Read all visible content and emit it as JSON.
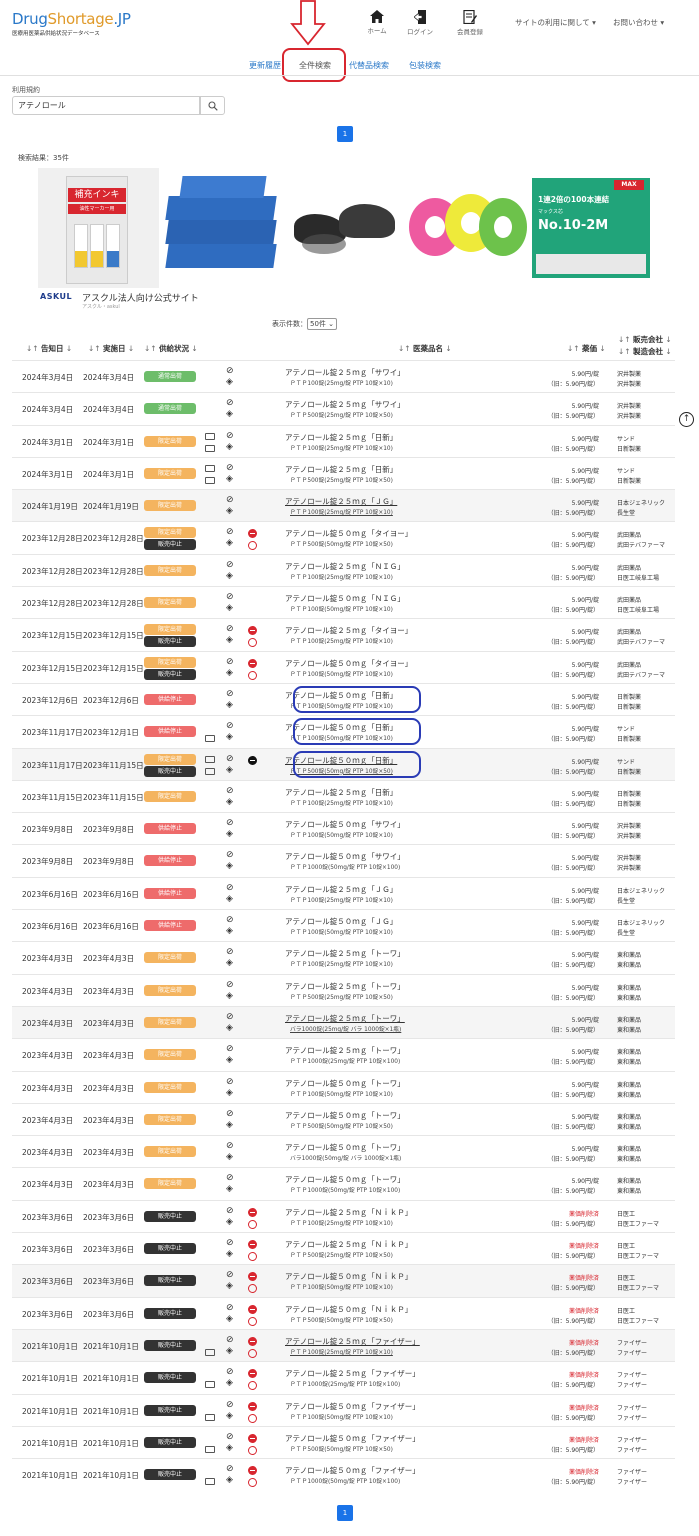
{
  "header": {
    "logo_main_a": "Drug",
    "logo_main_b": "Shortage",
    "logo_main_c": ".JP",
    "logo_sub": "医療用医薬品供給状況データベース",
    "nav": [
      {
        "icon": "home-icon",
        "label": "ホーム"
      },
      {
        "icon": "login-icon",
        "label": "ログイン"
      },
      {
        "icon": "register-icon",
        "label": "会員登録"
      }
    ],
    "about_menu": "サイトの利用に関して",
    "contact_menu": "お問い合わせ"
  },
  "tabs": [
    {
      "label": "更新履歴"
    },
    {
      "label": "全件検索"
    },
    {
      "label": "代替品検索"
    },
    {
      "label": "包装検索"
    }
  ],
  "search": {
    "label": "利用規約",
    "value": "アテノロール"
  },
  "pagination": {
    "current": "1"
  },
  "result_count": "検索結果：35件",
  "ad": {
    "brand": "ASKUL",
    "title": "アスクル法人向け公式サイト",
    "sub": "アスクル・askul",
    "tile_texts": {
      "ink_title": "補充インキ",
      "ink_sub": "油性マーカー用",
      "staple_top": "1連2倍の100本連結",
      "staple_brand": "マックス芯",
      "staple_model": "No.10-2M",
      "staple_brand2": "MAX"
    }
  },
  "per_page": {
    "label": "表示件数：",
    "value": "50件"
  },
  "columns": {
    "announce": "告知日",
    "effective": "実施日",
    "status": "供給状況",
    "name": "医薬品名",
    "price": "薬価",
    "seller": "販売会社",
    "maker": "製造会社"
  },
  "rows": [
    {
      "d1": "2024年3月4日",
      "d2": "2024年3月4日",
      "b1": "通常出荷",
      "c1": "green",
      "chat": 0,
      "stop": 0,
      "name": "アテノロール錠２５ｍｇ「サワイ」",
      "pkg": "ＰＴＰ100錠(25mg/錠 PTP 10錠×10)",
      "p1": "5.90円/錠",
      "p2": "（旧：5.90円/錠）",
      "co1": "沢井製薬",
      "co2": "沢井製薬"
    },
    {
      "d1": "2024年3月4日",
      "d2": "2024年3月4日",
      "b1": "通常出荷",
      "c1": "green",
      "chat": 0,
      "stop": 0,
      "name": "アテノロール錠２５ｍｇ「サワイ」",
      "pkg": "ＰＴＰ500錠(25mg/錠 PTP 10錠×50)",
      "p1": "5.90円/錠",
      "p2": "（旧：5.90円/錠）",
      "co1": "沢井製薬",
      "co2": "沢井製薬"
    },
    {
      "d1": "2024年3月1日",
      "d2": "2024年3月1日",
      "b1": "限定出荷",
      "c1": "orange",
      "chat": 2,
      "stop": 0,
      "name": "アテノロール錠２５ｍｇ「日新」",
      "pkg": "ＰＴＰ100錠(25mg/錠 PTP 10錠×10)",
      "p1": "5.90円/錠",
      "p2": "（旧：5.90円/錠）",
      "co1": "サンド",
      "co2": "日新製薬"
    },
    {
      "d1": "2024年3月1日",
      "d2": "2024年3月1日",
      "b1": "限定出荷",
      "c1": "orange",
      "chat": 2,
      "stop": 0,
      "name": "アテノロール錠２５ｍｇ「日新」",
      "pkg": "ＰＴＰ500錠(25mg/錠 PTP 10錠×50)",
      "p1": "5.90円/錠",
      "p2": "（旧：5.90円/錠）",
      "co1": "サンド",
      "co2": "日新製薬"
    },
    {
      "d1": "2024年1月19日",
      "d2": "2024年1月19日",
      "b1": "限定出荷",
      "c1": "orange",
      "chat": 0,
      "stop": 0,
      "alt": 1,
      "ul": 1,
      "name": "アテノロール錠２５ｍｇ「ＪＧ」",
      "pkg": "ＰＴＰ100錠(25mg/錠 PTP 10錠×10)",
      "p1": "5.90円/錠",
      "p2": "（旧：5.90円/錠）",
      "co1": "日本ジェネリック",
      "co2": "長生堂"
    },
    {
      "d1": "2023年12月28日",
      "d2": "2023年12月28日",
      "b1": "限定出荷",
      "c1": "orange",
      "b2": "販売中止",
      "chat": 0,
      "stop": 1,
      "name": "アテノロール錠５０ｍｇ「タイヨー」",
      "pkg": "ＰＴＰ500錠(50mg/錠 PTP 10錠×50)",
      "p1": "5.90円/錠",
      "p2": "（旧：5.90円/錠）",
      "co1": "武田薬品",
      "co2": "武田テバファーマ"
    },
    {
      "d1": "2023年12月28日",
      "d2": "2023年12月28日",
      "b1": "限定出荷",
      "c1": "orange",
      "chat": 0,
      "stop": 0,
      "name": "アテノロール錠２５ｍｇ「ＮＩＧ」",
      "pkg": "ＰＴＰ100錠(25mg/錠 PTP 10錠×10)",
      "p1": "5.90円/錠",
      "p2": "（旧：5.90円/錠）",
      "co1": "武田薬品",
      "co2": "日医工岐阜工場"
    },
    {
      "d1": "2023年12月28日",
      "d2": "2023年12月28日",
      "b1": "限定出荷",
      "c1": "orange",
      "chat": 0,
      "stop": 0,
      "name": "アテノロール錠５０ｍｇ「ＮＩＧ」",
      "pkg": "ＰＴＰ100錠(50mg/錠 PTP 10錠×10)",
      "p1": "5.90円/錠",
      "p2": "（旧：5.90円/錠）",
      "co1": "武田薬品",
      "co2": "日医工岐阜工場"
    },
    {
      "d1": "2023年12月15日",
      "d2": "2023年12月15日",
      "b1": "限定出荷",
      "c1": "orange",
      "b2": "販売中止",
      "chat": 0,
      "stop": 1,
      "name": "アテノロール錠２５ｍｇ「タイヨー」",
      "pkg": "ＰＴＰ100錠(25mg/錠 PTP 10錠×10)",
      "p1": "5.90円/錠",
      "p2": "（旧：5.90円/錠）",
      "co1": "武田薬品",
      "co2": "武田テバファーマ"
    },
    {
      "d1": "2023年12月15日",
      "d2": "2023年12月15日",
      "b1": "限定出荷",
      "c1": "orange",
      "b2": "販売中止",
      "chat": 0,
      "stop": 1,
      "name": "アテノロール錠５０ｍｇ「タイヨー」",
      "pkg": "ＰＴＰ100錠(50mg/錠 PTP 10錠×10)",
      "p1": "5.90円/錠",
      "p2": "（旧：5.90円/錠）",
      "co1": "武田薬品",
      "co2": "武田テバファーマ"
    },
    {
      "d1": "2023年12月6日",
      "d2": "2023年12月6日",
      "b1": "供給停止",
      "c1": "red",
      "chat": 0,
      "stop": 0,
      "hl": 1,
      "name": "アテノロール錠５０ｍｇ「日新」",
      "pkg": "ＰＴＰ100錠(50mg/錠 PTP 10錠×10)",
      "p1": "5.90円/錠",
      "p2": "（旧：5.90円/錠）",
      "co1": "日新製薬",
      "co2": "日新製薬"
    },
    {
      "d1": "2023年11月17日",
      "d2": "2023年12月1日",
      "b1": "供給停止",
      "c1": "red",
      "chat": 1,
      "stop": 0,
      "hl": 1,
      "name": "アテノロール錠５０ｍｇ「日新」",
      "pkg": "ＰＴＰ100錠(50mg/錠 PTP 10錠×10)",
      "p1": "5.90円/錠",
      "p2": "（旧：5.90円/錠）",
      "co1": "サンド",
      "co2": "日新製薬"
    },
    {
      "d1": "2023年11月17日",
      "d2": "2023年11月15日",
      "b1": "限定出荷",
      "c1": "orange",
      "b2": "販売中止",
      "chat": 2,
      "stop": 2,
      "hl": 1,
      "alt": 1,
      "ul": 1,
      "name": "アテノロール錠５０ｍｇ「日新」",
      "pkg": "ＰＴＰ500錠(50mg/錠 PTP 10錠×50)",
      "p1": "5.90円/錠",
      "p2": "（旧：5.90円/錠）",
      "co1": "サンド",
      "co2": "日新製薬"
    },
    {
      "d1": "2023年11月15日",
      "d2": "2023年11月15日",
      "b1": "限定出荷",
      "c1": "orange",
      "chat": 0,
      "stop": 0,
      "name": "アテノロール錠２５ｍｇ「日新」",
      "pkg": "ＰＴＰ100錠(25mg/錠 PTP 10錠×10)",
      "p1": "5.90円/錠",
      "p2": "（旧：5.90円/錠）",
      "co1": "日新製薬",
      "co2": "日新製薬"
    },
    {
      "d1": "2023年9月8日",
      "d2": "2023年9月8日",
      "b1": "供給停止",
      "c1": "red",
      "chat": 0,
      "stop": 0,
      "name": "アテノロール錠５０ｍｇ「サワイ」",
      "pkg": "ＰＴＰ100錠(50mg/錠 PTP 10錠×10)",
      "p1": "5.90円/錠",
      "p2": "（旧：5.90円/錠）",
      "co1": "沢井製薬",
      "co2": "沢井製薬"
    },
    {
      "d1": "2023年9月8日",
      "d2": "2023年9月8日",
      "b1": "供給停止",
      "c1": "red",
      "chat": 0,
      "stop": 0,
      "name": "アテノロール錠５０ｍｇ「サワイ」",
      "pkg": "ＰＴＰ1000錠(50mg/錠 PTP 10錠×100)",
      "p1": "5.90円/錠",
      "p2": "（旧：5.90円/錠）",
      "co1": "沢井製薬",
      "co2": "沢井製薬"
    },
    {
      "d1": "2023年6月16日",
      "d2": "2023年6月16日",
      "b1": "供給停止",
      "c1": "red",
      "chat": 0,
      "stop": 0,
      "name": "アテノロール錠２５ｍｇ「ＪＧ」",
      "pkg": "ＰＴＰ100錠(25mg/錠 PTP 10錠×10)",
      "p1": "5.90円/錠",
      "p2": "（旧：5.90円/錠）",
      "co1": "日本ジェネリック",
      "co2": "長生堂"
    },
    {
      "d1": "2023年6月16日",
      "d2": "2023年6月16日",
      "b1": "供給停止",
      "c1": "red",
      "chat": 0,
      "stop": 0,
      "name": "アテノロール錠５０ｍｇ「ＪＧ」",
      "pkg": "ＰＴＰ100錠(50mg/錠 PTP 10錠×10)",
      "p1": "5.90円/錠",
      "p2": "（旧：5.90円/錠）",
      "co1": "日本ジェネリック",
      "co2": "長生堂"
    },
    {
      "d1": "2023年4月3日",
      "d2": "2023年4月3日",
      "b1": "限定出荷",
      "c1": "orange",
      "chat": 0,
      "stop": 0,
      "name": "アテノロール錠２５ｍｇ「トーワ」",
      "pkg": "ＰＴＰ100錠(25mg/錠 PTP 10錠×10)",
      "p1": "5.90円/錠",
      "p2": "（旧：5.90円/錠）",
      "co1": "東和薬品",
      "co2": "東和薬品"
    },
    {
      "d1": "2023年4月3日",
      "d2": "2023年4月3日",
      "b1": "限定出荷",
      "c1": "orange",
      "chat": 0,
      "stop": 0,
      "name": "アテノロール錠２５ｍｇ「トーワ」",
      "pkg": "ＰＴＰ500錠(25mg/錠 PTP 10錠×50)",
      "p1": "5.90円/錠",
      "p2": "（旧：5.90円/錠）",
      "co1": "東和薬品",
      "co2": "東和薬品"
    },
    {
      "d1": "2023年4月3日",
      "d2": "2023年4月3日",
      "b1": "限定出荷",
      "c1": "orange",
      "chat": 0,
      "stop": 0,
      "alt": 1,
      "ul": 1,
      "name": "アテノロール錠２５ｍｇ「トーワ」",
      "pkg": "バラ1000錠(25mg/錠 バラ 1000錠×1瓶)",
      "p1": "5.90円/錠",
      "p2": "（旧：5.90円/錠）",
      "co1": "東和薬品",
      "co2": "東和薬品"
    },
    {
      "d1": "2023年4月3日",
      "d2": "2023年4月3日",
      "b1": "限定出荷",
      "c1": "orange",
      "chat": 0,
      "stop": 0,
      "name": "アテノロール錠２５ｍｇ「トーワ」",
      "pkg": "ＰＴＰ1000錠(25mg/錠 PTP 10錠×100)",
      "p1": "5.90円/錠",
      "p2": "（旧：5.90円/錠）",
      "co1": "東和薬品",
      "co2": "東和薬品"
    },
    {
      "d1": "2023年4月3日",
      "d2": "2023年4月3日",
      "b1": "限定出荷",
      "c1": "orange",
      "chat": 0,
      "stop": 0,
      "name": "アテノロール錠５０ｍｇ「トーワ」",
      "pkg": "ＰＴＰ100錠(50mg/錠 PTP 10錠×10)",
      "p1": "5.90円/錠",
      "p2": "（旧：5.90円/錠）",
      "co1": "東和薬品",
      "co2": "東和薬品"
    },
    {
      "d1": "2023年4月3日",
      "d2": "2023年4月3日",
      "b1": "限定出荷",
      "c1": "orange",
      "chat": 0,
      "stop": 0,
      "name": "アテノロール錠５０ｍｇ「トーワ」",
      "pkg": "ＰＴＰ500錠(50mg/錠 PTP 10錠×50)",
      "p1": "5.90円/錠",
      "p2": "（旧：5.90円/錠）",
      "co1": "東和薬品",
      "co2": "東和薬品"
    },
    {
      "d1": "2023年4月3日",
      "d2": "2023年4月3日",
      "b1": "限定出荷",
      "c1": "orange",
      "chat": 0,
      "stop": 0,
      "name": "アテノロール錠５０ｍｇ「トーワ」",
      "pkg": "バラ1000錠(50mg/錠 バラ 1000錠×1瓶)",
      "p1": "5.90円/錠",
      "p2": "（旧：5.90円/錠）",
      "co1": "東和薬品",
      "co2": "東和薬品"
    },
    {
      "d1": "2023年4月3日",
      "d2": "2023年4月3日",
      "b1": "限定出荷",
      "c1": "orange",
      "chat": 0,
      "stop": 0,
      "name": "アテノロール錠５０ｍｇ「トーワ」",
      "pkg": "ＰＴＰ1000錠(50mg/錠 PTP 10錠×100)",
      "p1": "5.90円/錠",
      "p2": "（旧：5.90円/錠）",
      "co1": "東和薬品",
      "co2": "東和薬品"
    },
    {
      "d1": "2023年3月6日",
      "d2": "2023年3月6日",
      "b1": "販売中止",
      "c1": "black",
      "chat": 0,
      "stop": 1,
      "name": "アテノロール錠２５ｍｇ「ＮｉｋＰ」",
      "pkg": "ＰＴＰ100錠(25mg/錠 PTP 10錠×10)",
      "p1": "薬価削除済",
      "p2": "（旧：5.90円/錠）",
      "pr": 1,
      "co1": "日医工",
      "co2": "日医工ファーマ"
    },
    {
      "d1": "2023年3月6日",
      "d2": "2023年3月6日",
      "b1": "販売中止",
      "c1": "black",
      "chat": 0,
      "stop": 1,
      "name": "アテノロール錠２５ｍｇ「ＮｉｋＰ」",
      "pkg": "ＰＴＰ500錠(25mg/錠 PTP 10錠×50)",
      "p1": "薬価削除済",
      "p2": "（旧：5.90円/錠）",
      "pr": 1,
      "co1": "日医工",
      "co2": "日医工ファーマ"
    },
    {
      "d1": "2023年3月6日",
      "d2": "2023年3月6日",
      "b1": "販売中止",
      "c1": "black",
      "chat": 0,
      "stop": 1,
      "alt": 1,
      "name": "アテノロール錠５０ｍｇ「ＮｉｋＰ」",
      "pkg": "ＰＴＰ100錠(50mg/錠 PTP 10錠×10)",
      "p1": "薬価削除済",
      "p2": "（旧：5.90円/錠）",
      "pr": 1,
      "co1": "日医工",
      "co2": "日医工ファーマ"
    },
    {
      "d1": "2023年3月6日",
      "d2": "2023年3月6日",
      "b1": "販売中止",
      "c1": "black",
      "chat": 0,
      "stop": 1,
      "name": "アテノロール錠５０ｍｇ「ＮｉｋＰ」",
      "pkg": "ＰＴＰ500錠(50mg/錠 PTP 10錠×50)",
      "p1": "薬価削除済",
      "p2": "（旧：5.90円/錠）",
      "pr": 1,
      "co1": "日医工",
      "co2": "日医工ファーマ"
    },
    {
      "d1": "2021年10月1日",
      "d2": "2021年10月1日",
      "b1": "販売中止",
      "c1": "black",
      "chat": 1,
      "stop": 1,
      "alt": 1,
      "ul": 1,
      "name": "アテノロール錠２５ｍｇ「ファイザー」",
      "pkg": "ＰＴＰ100錠(25mg/錠 PTP 10錠×10)",
      "p1": "薬価削除済",
      "p2": "（旧：5.90円/錠）",
      "pr": 1,
      "co1": "ファイザー",
      "co2": "ファイザー"
    },
    {
      "d1": "2021年10月1日",
      "d2": "2021年10月1日",
      "b1": "販売中止",
      "c1": "black",
      "chat": 1,
      "stop": 1,
      "name": "アテノロール錠２５ｍｇ「ファイザー」",
      "pkg": "ＰＴＰ1000錠(25mg/錠 PTP 10錠×100)",
      "p1": "薬価削除済",
      "p2": "（旧：5.90円/錠）",
      "pr": 1,
      "co1": "ファイザー",
      "co2": "ファイザー"
    },
    {
      "d1": "2021年10月1日",
      "d2": "2021年10月1日",
      "b1": "販売中止",
      "c1": "black",
      "chat": 1,
      "stop": 1,
      "name": "アテノロール錠５０ｍｇ「ファイザー」",
      "pkg": "ＰＴＰ100錠(50mg/錠 PTP 10錠×10)",
      "p1": "薬価削除済",
      "p2": "（旧：5.90円/錠）",
      "pr": 1,
      "co1": "ファイザー",
      "co2": "ファイザー"
    },
    {
      "d1": "2021年10月1日",
      "d2": "2021年10月1日",
      "b1": "販売中止",
      "c1": "black",
      "chat": 1,
      "stop": 1,
      "name": "アテノロール錠５０ｍｇ「ファイザー」",
      "pkg": "ＰＴＰ500錠(50mg/錠 PTP 10錠×50)",
      "p1": "薬価削除済",
      "p2": "（旧：5.90円/錠）",
      "pr": 1,
      "co1": "ファイザー",
      "co2": "ファイザー"
    },
    {
      "d1": "2021年10月1日",
      "d2": "2021年10月1日",
      "b1": "販売中止",
      "c1": "black",
      "chat": 1,
      "stop": 1,
      "name": "アテノロール錠５０ｍｇ「ファイザー」",
      "pkg": "ＰＴＰ1000錠(50mg/錠 PTP 10錠×100)",
      "p1": "薬価削除済",
      "p2": "（旧：5.90円/錠）",
      "pr": 1,
      "co1": "ファイザー",
      "co2": "ファイザー"
    }
  ]
}
